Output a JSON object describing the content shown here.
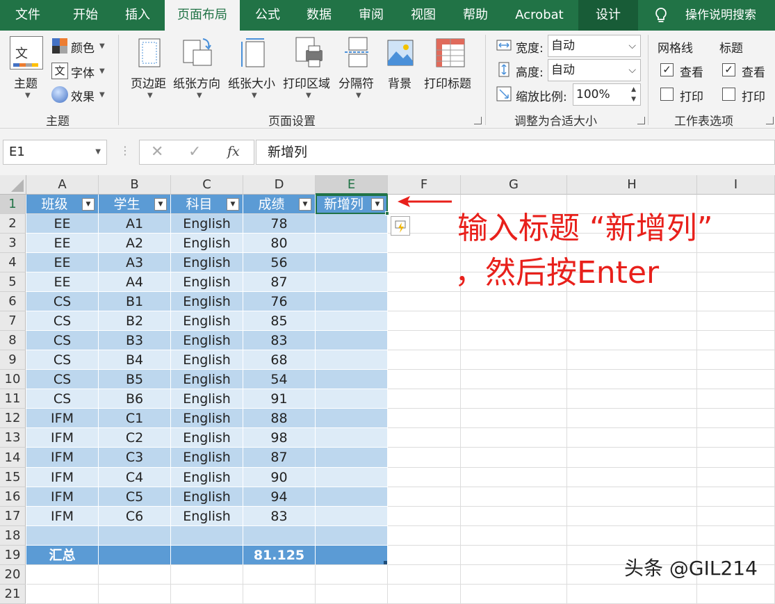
{
  "tabs": [
    "文件",
    "开始",
    "插入",
    "页面布局",
    "公式",
    "数据",
    "审阅",
    "视图",
    "帮助",
    "Acrobat",
    "设计"
  ],
  "tell_me": "操作说明搜索",
  "ribbon": {
    "theme_group": {
      "main_label": "主题",
      "colors": "颜色",
      "fonts": "字体",
      "effects": "效果",
      "group_label": "主题"
    },
    "page_setup": {
      "margins": "页边距",
      "orientation": "纸张方向",
      "size": "纸张大小",
      "print_area": "打印区域",
      "breaks": "分隔符",
      "background": "背景",
      "print_titles": "打印标题",
      "group_label": "页面设置"
    },
    "scale_fit": {
      "width_label": "宽度:",
      "width_value": "自动",
      "height_label": "高度:",
      "height_value": "自动",
      "scale_label": "缩放比例:",
      "scale_value": "100%",
      "group_label": "调整为合适大小"
    },
    "sheet_options": {
      "gridlines": "网格线",
      "headings": "标题",
      "view": "查看",
      "print": "打印",
      "group_label": "工作表选项"
    }
  },
  "formula_bar": {
    "name_box": "E1",
    "fx": "fx",
    "formula": "新增列"
  },
  "columns": [
    "A",
    "B",
    "C",
    "D",
    "E",
    "F",
    "G",
    "H",
    "I"
  ],
  "rows": [
    "1",
    "2",
    "3",
    "4",
    "5",
    "6",
    "7",
    "8",
    "9",
    "10",
    "11",
    "12",
    "13",
    "14",
    "15",
    "16",
    "17",
    "18",
    "19",
    "20",
    "21"
  ],
  "table": {
    "headers": [
      "班级",
      "学生",
      "科目",
      "成绩",
      "新增列"
    ],
    "data": [
      [
        "EE",
        "A1",
        "English",
        "78"
      ],
      [
        "EE",
        "A2",
        "English",
        "80"
      ],
      [
        "EE",
        "A3",
        "English",
        "56"
      ],
      [
        "EE",
        "A4",
        "English",
        "87"
      ],
      [
        "CS",
        "B1",
        "English",
        "76"
      ],
      [
        "CS",
        "B2",
        "English",
        "85"
      ],
      [
        "CS",
        "B3",
        "English",
        "83"
      ],
      [
        "CS",
        "B4",
        "English",
        "68"
      ],
      [
        "CS",
        "B5",
        "English",
        "54"
      ],
      [
        "CS",
        "B6",
        "English",
        "91"
      ],
      [
        "IFM",
        "C1",
        "English",
        "88"
      ],
      [
        "IFM",
        "C2",
        "English",
        "98"
      ],
      [
        "IFM",
        "C3",
        "English",
        "87"
      ],
      [
        "IFM",
        "C4",
        "English",
        "90"
      ],
      [
        "IFM",
        "C5",
        "English",
        "94"
      ],
      [
        "IFM",
        "C6",
        "English",
        "83"
      ]
    ],
    "total_label": "汇总",
    "total_value": "81.125"
  },
  "annotation": {
    "line1": "输入标题 “新增列”",
    "line2": "，然后按Enter",
    "color": "#e8201b"
  },
  "watermark": "头条 @GIL214",
  "colors": {
    "accent": "#217346",
    "table_header": "#5b9bd5",
    "band_dark": "#bdd7ee",
    "band_light": "#ddebf7"
  }
}
